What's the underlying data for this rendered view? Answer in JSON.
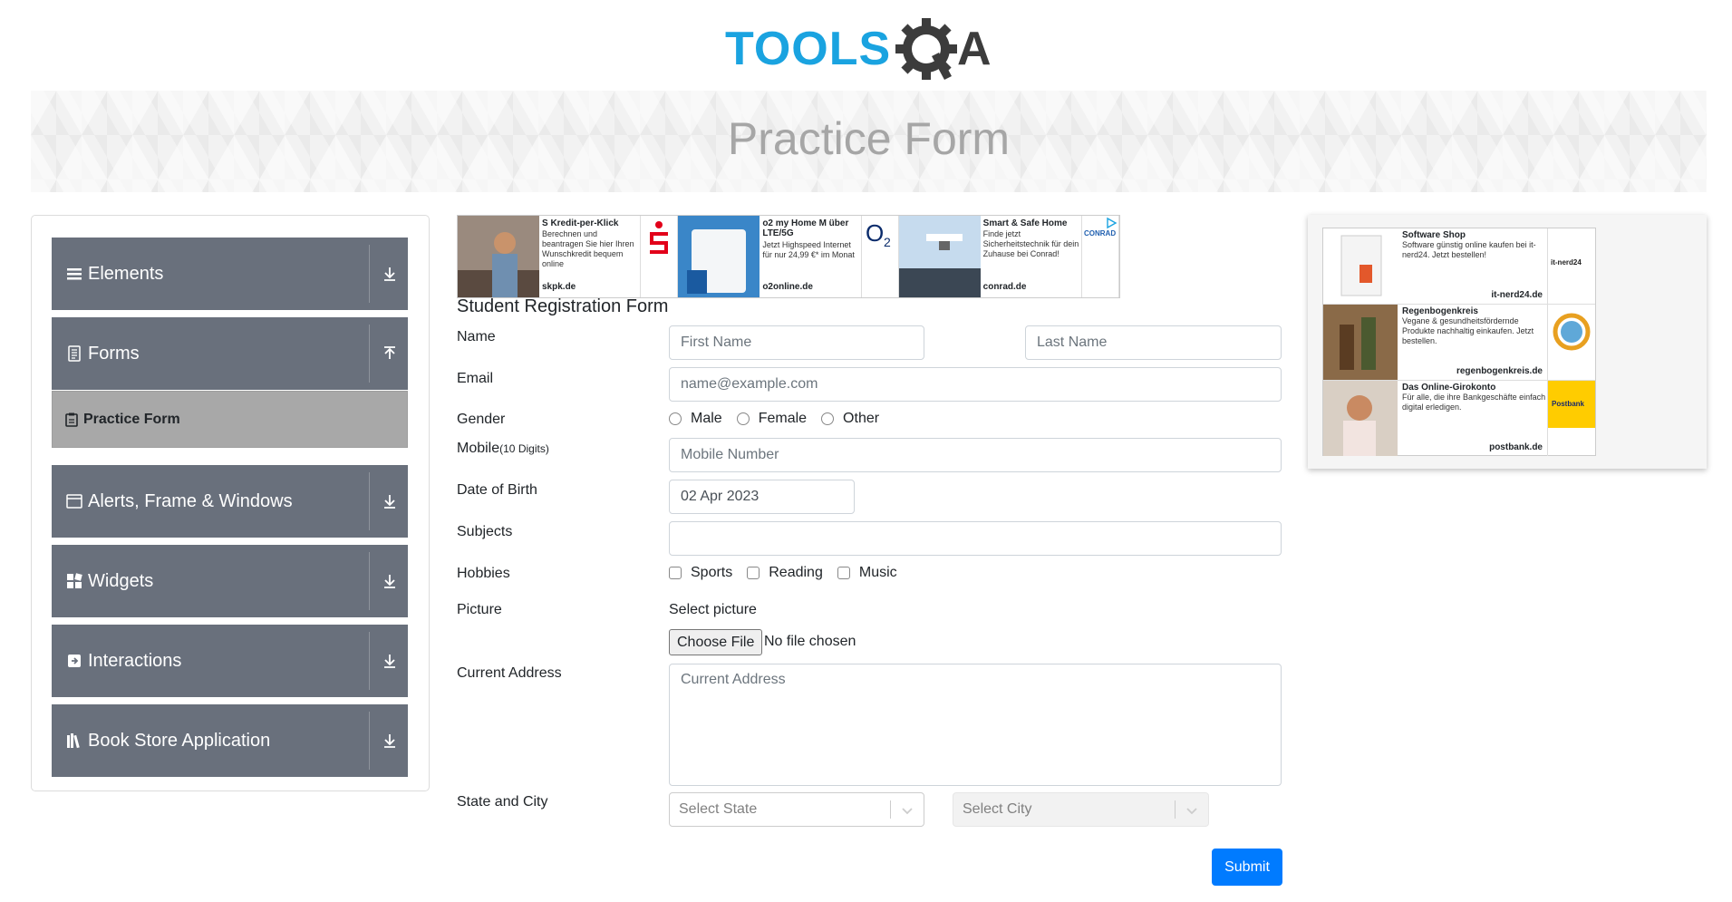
{
  "logo": {
    "text": "TOOLSQA"
  },
  "banner": {
    "title": "Practice Form"
  },
  "sidebar": {
    "groups": [
      {
        "label": "Elements",
        "icon": "list-icon",
        "expanded": false
      },
      {
        "label": "Forms",
        "icon": "document-icon",
        "expanded": true
      },
      {
        "label": "Alerts, Frame & Windows",
        "icon": "window-icon",
        "expanded": false
      },
      {
        "label": "Widgets",
        "icon": "widgets-icon",
        "expanded": false
      },
      {
        "label": "Interactions",
        "icon": "interactions-icon",
        "expanded": false
      },
      {
        "label": "Book Store Application",
        "icon": "books-icon",
        "expanded": false
      }
    ],
    "active_item": {
      "label": "Practice Form",
      "icon": "clipboard-icon"
    }
  },
  "ads_top": [
    {
      "title": "S Kredit-per-Klick",
      "body": "Berechnen und beantragen Sie hier Ihren Wunschkredit bequem online",
      "domain": "skpk.de"
    },
    {
      "title": "o2 my Home M über LTE/5G",
      "body": "Jetzt Highspeed Internet für nur 24,99 €* im Monat",
      "domain": "o2online.de"
    },
    {
      "title": "Smart & Safe Home",
      "body": "Finde jetzt Sicherheitstechnik für dein Zuhause bei Conrad!",
      "domain": "conrad.de"
    }
  ],
  "ads_side": [
    {
      "title": "Software Shop",
      "body": "Software günstig online kaufen bei it-nerd24. Jetzt bestellen!",
      "domain": "it-nerd24.de"
    },
    {
      "title": "Regenbogenkreis",
      "body": "Vegane & gesundheitsfördernde Produkte nachhaltig einkaufen. Jetzt bestellen.",
      "domain": "regenbogenkreis.de"
    },
    {
      "title": "Das Online-Girokonto",
      "body": "Für alle, die ihre Bankgeschäfte einfach digital erledigen.",
      "domain": "postbank.de"
    }
  ],
  "form": {
    "title": "Student Registration Form",
    "labels": {
      "name": "Name",
      "email": "Email",
      "gender": "Gender",
      "mobile": "Mobile",
      "mobile_hint": "(10 Digits)",
      "dob": "Date of Birth",
      "subjects": "Subjects",
      "hobbies": "Hobbies",
      "picture": "Picture",
      "address": "Current Address",
      "state_city": "State and City"
    },
    "placeholders": {
      "first_name": "First Name",
      "last_name": "Last Name",
      "email": "name@example.com",
      "mobile": "Mobile Number",
      "address": "Current Address"
    },
    "values": {
      "first_name": "",
      "last_name": "",
      "email": "",
      "mobile": "",
      "dob": "02 Apr 2023",
      "subjects": ""
    },
    "gender_options": [
      "Male",
      "Female",
      "Other"
    ],
    "hobby_options": [
      "Sports",
      "Reading",
      "Music"
    ],
    "picture": {
      "prompt": "Select picture",
      "button": "Choose File",
      "status": "No file chosen"
    },
    "state": {
      "placeholder": "Select State"
    },
    "city": {
      "placeholder": "Select City"
    },
    "submit": "Submit"
  },
  "colors": {
    "sidebar_group": "#69707c",
    "active_item": "#a8a8a8",
    "submit": "#007bff",
    "logo_blue": "#1aa3e0",
    "logo_dark": "#3c3c3c"
  }
}
